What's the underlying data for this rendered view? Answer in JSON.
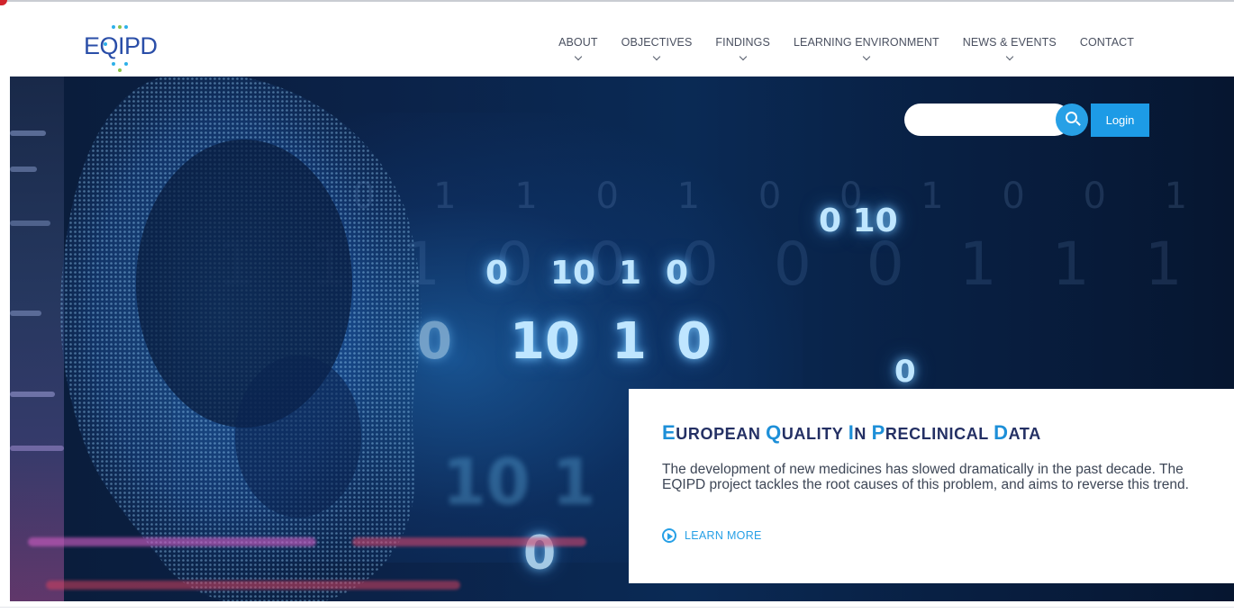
{
  "header": {
    "logo_text": "EQIPD",
    "nav": [
      {
        "label": "ABOUT"
      },
      {
        "label": "OBJECTIVES"
      },
      {
        "label": "FINDINGS"
      },
      {
        "label": "LEARNING ENVIRONMENT"
      },
      {
        "label": "NEWS & EVENTS"
      },
      {
        "label": "CONTACT"
      }
    ]
  },
  "hero": {
    "search": {
      "placeholder": "",
      "value": ""
    },
    "login_label": "Login",
    "binary_text": {
      "row1": "0 10",
      "row2a": "0",
      "row2b": "10",
      "row2c": "1",
      "row2d": "0",
      "row3a": "0",
      "row3b": "10",
      "row3c": "1",
      "row3d": "0",
      "row4": "0",
      "row5": "0"
    },
    "panel": {
      "title_parts": [
        {
          "cap": "E",
          "rest": "UROPEAN "
        },
        {
          "cap": "Q",
          "rest": "UALITY "
        },
        {
          "cap": "I",
          "rest": "N "
        },
        {
          "cap": "P",
          "rest": "RECLINICAL "
        },
        {
          "cap": "D",
          "rest": "ATA"
        }
      ],
      "description": "The development of new medicines has slowed dramatically in the past decade. The EQIPD project tackles the root causes of this problem, and aims to reverse this trend.",
      "learn_more": "LEARN MORE"
    }
  },
  "colors": {
    "accent": "#27a0e6",
    "brand_navy": "#243064",
    "hero_bg": "#0a2248"
  },
  "icons": [
    "search-icon",
    "play-circle-icon",
    "chevron-down-icon"
  ]
}
